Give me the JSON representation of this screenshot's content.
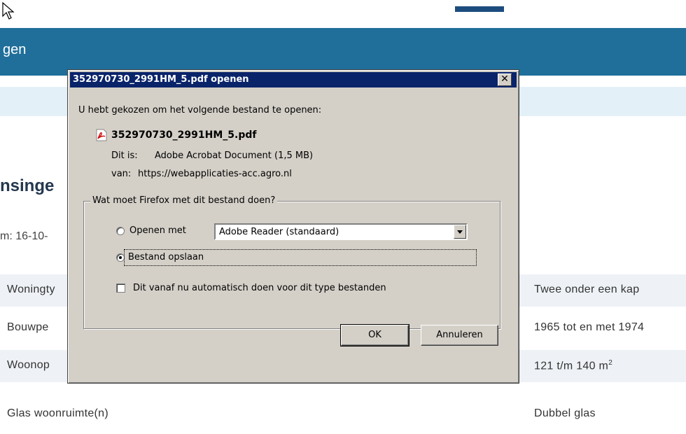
{
  "background": {
    "banner_text": "gen",
    "heading": "nsinge",
    "meta_text": "m: 16-10-",
    "rows": [
      {
        "label": "Woningty",
        "value": "Twee onder een kap"
      },
      {
        "label": "Bouwpe",
        "value": "1965 tot en met 1974"
      },
      {
        "label": "Woonop",
        "value": "121 t/m 140 m",
        "value_sup": "2"
      },
      {
        "label": "Glas woonruimte(n)",
        "value": "Dubbel glas"
      }
    ]
  },
  "dialog": {
    "title": "352970730_2991HM_5.pdf openen",
    "close_glyph": "✕",
    "intro": "U hebt gekozen om het volgende bestand te openen:",
    "file_name": "352970730_2991HM_5.pdf",
    "type_label": "Dit is:",
    "type_value": "Adobe Acrobat Document (1,5 MB)",
    "source_label": "van:",
    "source_value": "https://webapplicaties-acc.agro.nl",
    "group_label": "Wat moet Firefox met dit bestand doen?",
    "open_with_label": "Openen met",
    "open_with_selected": false,
    "app_select_value": "Adobe Reader  (standaard)",
    "save_label": "Bestand opslaan",
    "save_selected": true,
    "auto_label": "Dit vanaf nu automatisch doen voor dit type bestanden",
    "auto_checked": false,
    "ok_label": "OK",
    "cancel_label": "Annuleren"
  },
  "icons": {
    "pdf": "pdf-file-icon",
    "cursor": "mouse-pointer-icon",
    "close": "close-icon",
    "dropdown": "chevron-down-icon"
  },
  "colors": {
    "titlebar": "#0a246a",
    "dialog_face": "#d4d0c8",
    "banner": "#1f6f9a"
  }
}
